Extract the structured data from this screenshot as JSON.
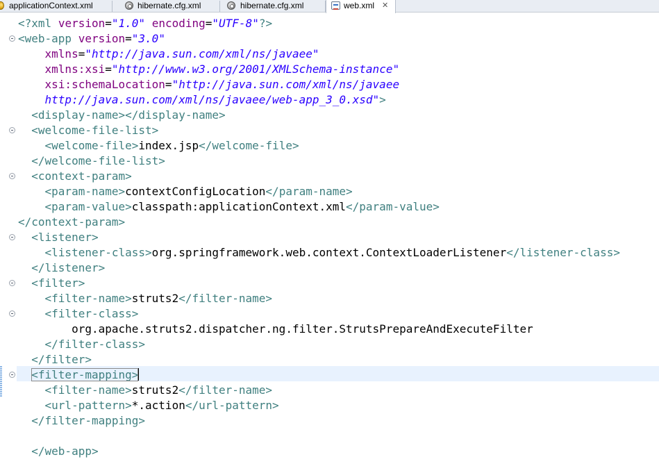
{
  "tabs": [
    {
      "label": "applicationContext.xml",
      "icon": "spring-config-icon",
      "active": false
    },
    {
      "label": "hibernate.cfg.xml",
      "icon": "hibernate-config-icon",
      "active": false
    },
    {
      "label": "hibernate.cfg.xml",
      "icon": "hibernate-config-icon",
      "active": false
    },
    {
      "label": "web.xml",
      "icon": "xml-file-icon",
      "active": true,
      "close": "✕"
    }
  ],
  "editor": {
    "lines": [
      {
        "indent": "",
        "parts": [
          [
            "pi",
            "<?"
          ],
          [
            "tag",
            "xml"
          ],
          [
            "txt",
            " "
          ],
          [
            "attr",
            "version"
          ],
          [
            "txt",
            "="
          ],
          [
            "str",
            "\"1.0\""
          ],
          [
            "txt",
            " "
          ],
          [
            "attr",
            "encoding"
          ],
          [
            "txt",
            "="
          ],
          [
            "str",
            "\"UTF-8\""
          ],
          [
            "pi",
            "?>"
          ]
        ]
      },
      {
        "indent": "",
        "parts": [
          [
            "tag",
            "<web-app"
          ],
          [
            "txt",
            " "
          ],
          [
            "attr",
            "version"
          ],
          [
            "txt",
            "="
          ],
          [
            "str",
            "\"3.0\""
          ]
        ]
      },
      {
        "indent": "    ",
        "parts": [
          [
            "attr",
            "xmlns"
          ],
          [
            "txt",
            "="
          ],
          [
            "str",
            "\"http://java.sun.com/xml/ns/javaee\""
          ]
        ]
      },
      {
        "indent": "    ",
        "parts": [
          [
            "attr",
            "xmlns:xsi"
          ],
          [
            "txt",
            "="
          ],
          [
            "str",
            "\"http://www.w3.org/2001/XMLSchema-instance\""
          ]
        ]
      },
      {
        "indent": "    ",
        "parts": [
          [
            "attr",
            "xsi:schemaLocation"
          ],
          [
            "txt",
            "="
          ],
          [
            "str",
            "\"http://java.sun.com/xml/ns/javaee"
          ]
        ]
      },
      {
        "indent": "    ",
        "parts": [
          [
            "str",
            "http://java.sun.com/xml/ns/javaee/web-app_3_0.xsd\""
          ],
          [
            "tag",
            ">"
          ]
        ]
      },
      {
        "indent": "  ",
        "parts": [
          [
            "tag",
            "<display-name></display-name>"
          ]
        ]
      },
      {
        "indent": "  ",
        "parts": [
          [
            "tag",
            "<welcome-file-list>"
          ]
        ]
      },
      {
        "indent": "    ",
        "parts": [
          [
            "tag",
            "<welcome-file>"
          ],
          [
            "txt",
            "index.jsp"
          ],
          [
            "tag",
            "</welcome-file>"
          ]
        ]
      },
      {
        "indent": "  ",
        "parts": [
          [
            "tag",
            "</welcome-file-list>"
          ]
        ]
      },
      {
        "indent": "  ",
        "parts": [
          [
            "tag",
            "<context-param>"
          ]
        ]
      },
      {
        "indent": "    ",
        "parts": [
          [
            "tag",
            "<param-name>"
          ],
          [
            "txt",
            "contextConfigLocation"
          ],
          [
            "tag",
            "</param-name>"
          ]
        ]
      },
      {
        "indent": "    ",
        "parts": [
          [
            "tag",
            "<param-value>"
          ],
          [
            "txt",
            "classpath:applicationContext.xml"
          ],
          [
            "tag",
            "</param-value>"
          ]
        ]
      },
      {
        "indent": "",
        "parts": [
          [
            "tag",
            "</context-param>"
          ]
        ]
      },
      {
        "indent": "  ",
        "parts": [
          [
            "tag",
            "<listener>"
          ]
        ]
      },
      {
        "indent": "    ",
        "parts": [
          [
            "tag",
            "<listener-class>"
          ],
          [
            "txt",
            "org.springframework.web.context.ContextLoaderListener"
          ],
          [
            "tag",
            "</listener-class>"
          ]
        ]
      },
      {
        "indent": "  ",
        "parts": [
          [
            "tag",
            "</listener>"
          ]
        ]
      },
      {
        "indent": "  ",
        "parts": [
          [
            "tag",
            "<filter>"
          ]
        ]
      },
      {
        "indent": "    ",
        "parts": [
          [
            "tag",
            "<filter-name>"
          ],
          [
            "txt",
            "struts2"
          ],
          [
            "tag",
            "</filter-name>"
          ]
        ]
      },
      {
        "indent": "    ",
        "parts": [
          [
            "tag",
            "<filter-class>"
          ]
        ]
      },
      {
        "indent": "        ",
        "parts": [
          [
            "txt",
            "org.apache.struts2.dispatcher.ng.filter.StrutsPrepareAndExecuteFilter"
          ]
        ]
      },
      {
        "indent": "    ",
        "parts": [
          [
            "tag",
            "</filter-class>"
          ]
        ]
      },
      {
        "indent": "  ",
        "parts": [
          [
            "tag",
            "</filter>"
          ]
        ]
      },
      {
        "indent": "  ",
        "parts": [
          [
            "tag",
            "<filter-mapping>"
          ]
        ]
      },
      {
        "indent": "    ",
        "parts": [
          [
            "tag",
            "<filter-name>"
          ],
          [
            "txt",
            "struts2"
          ],
          [
            "tag",
            "</filter-name>"
          ]
        ]
      },
      {
        "indent": "    ",
        "parts": [
          [
            "tag",
            "<url-pattern>"
          ],
          [
            "txt",
            "*.action"
          ],
          [
            "tag",
            "</url-pattern>"
          ]
        ]
      },
      {
        "indent": "  ",
        "parts": [
          [
            "tag",
            "</filter-mapping>"
          ]
        ]
      },
      {
        "indent": "",
        "parts": []
      },
      {
        "indent": "  ",
        "parts": [
          [
            "tag",
            "</web-app>"
          ]
        ]
      }
    ],
    "fold_lines": [
      2,
      8,
      11,
      15,
      18,
      20,
      24
    ],
    "current_line": 24
  },
  "colors": {
    "tag": "#3f7f7f",
    "attribute": "#7f007f",
    "string": "#2a00ff",
    "text": "#000000",
    "current_line_highlight": "#e8f2fe"
  }
}
